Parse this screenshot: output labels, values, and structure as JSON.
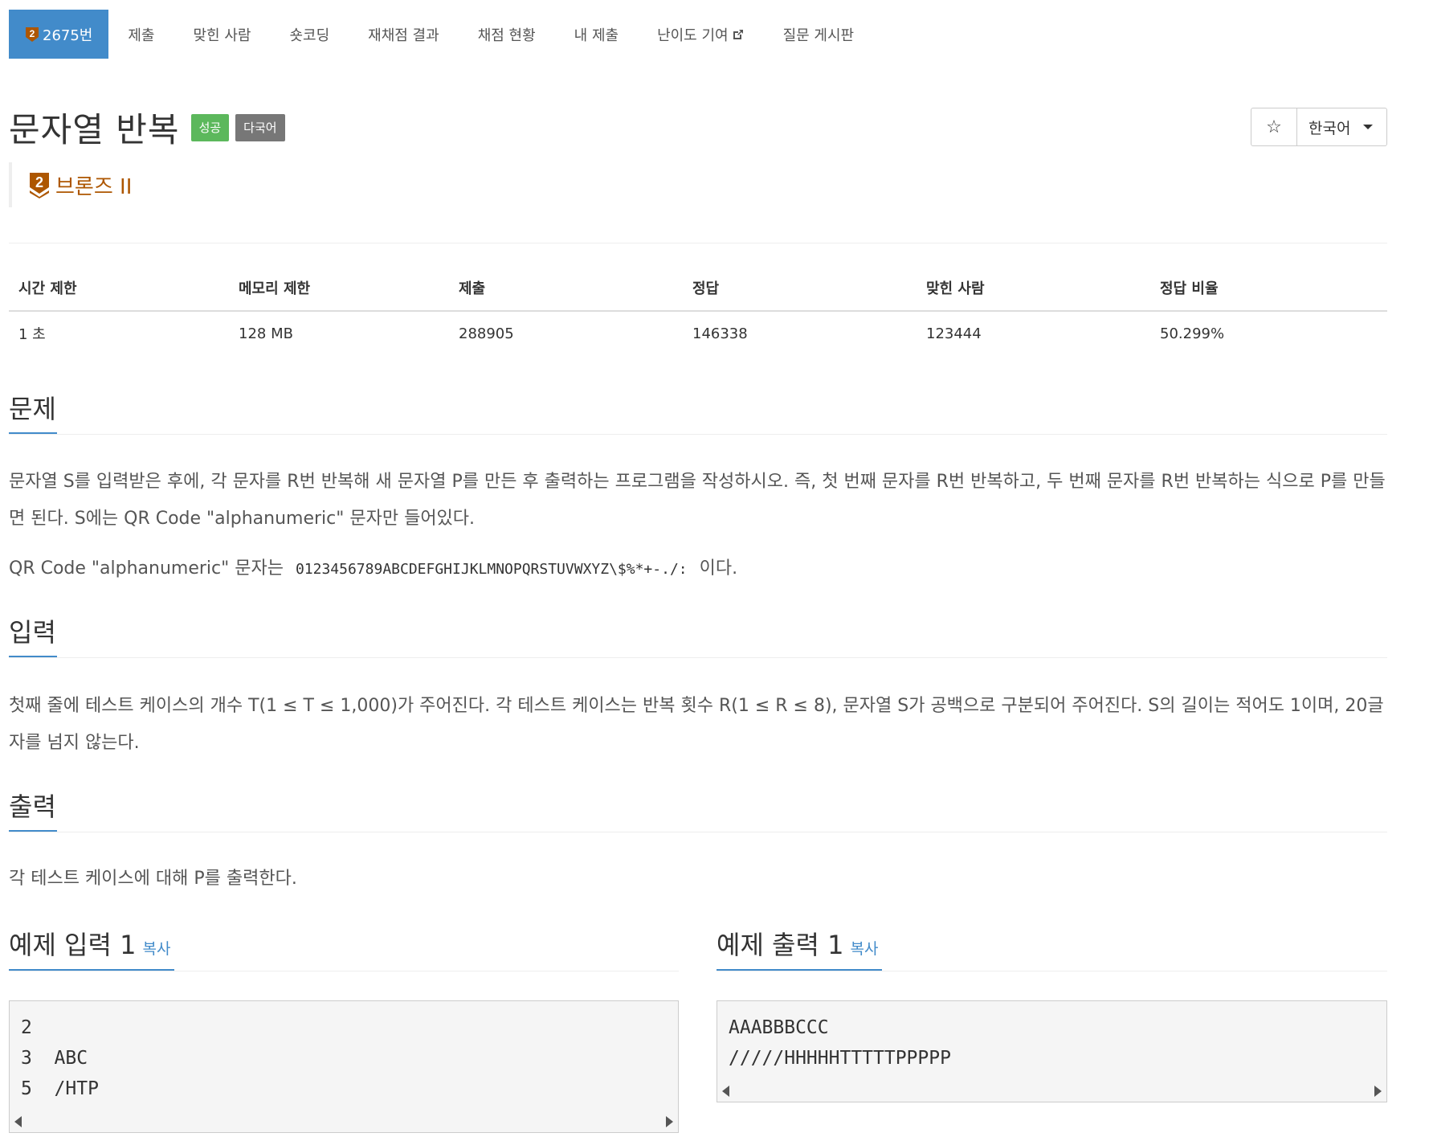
{
  "nav": {
    "items": [
      {
        "label": "2675번",
        "active": true
      },
      {
        "label": "제출"
      },
      {
        "label": "맞힌 사람"
      },
      {
        "label": "숏코딩"
      },
      {
        "label": "재채점 결과"
      },
      {
        "label": "채점 현황"
      },
      {
        "label": "내 제출"
      },
      {
        "label": "난이도 기여"
      },
      {
        "label": "질문 게시판"
      }
    ],
    "badge_number": "2"
  },
  "problem": {
    "title": "문자열 반복",
    "labels": [
      "성공",
      "다국어"
    ],
    "tier": "브론즈 II",
    "tier_number": "2",
    "tier_color": "#ad5600",
    "language": "한국어"
  },
  "info": {
    "headers": [
      "시간 제한",
      "메모리 제한",
      "제출",
      "정답",
      "맞힌 사람",
      "정답 비율"
    ],
    "values": [
      "1 초",
      "128 MB",
      "288905",
      "146338",
      "123444",
      "50.299%"
    ]
  },
  "sections": {
    "description": {
      "title": "문제",
      "p1": "문자열 S를 입력받은 후에, 각 문자를 R번 반복해 새 문자열 P를 만든 후 출력하는 프로그램을 작성하시오. 즉, 첫 번째 문자를 R번 반복하고, 두 번째 문자를 R번 반복하는 식으로 P를 만들면 된다. S에는 QR Code \"alphanumeric\" 문자만 들어있다.",
      "p2_prefix": "QR Code \"alphanumeric\" 문자는",
      "p2_code": "0123456789ABCDEFGHIJKLMNOPQRSTUVWXYZ\\$%*+-./:",
      "p2_suffix": "이다."
    },
    "input": {
      "title": "입력",
      "text": "첫째 줄에 테스트 케이스의 개수 T(1 ≤ T ≤ 1,000)가 주어진다. 각 테스트 케이스는 반복 횟수 R(1 ≤ R ≤ 8), 문자열 S가 공백으로 구분되어 주어진다. S의 길이는 적어도 1이며, 20글자를 넘지 않는다."
    },
    "output": {
      "title": "출력",
      "text": "각 테스트 케이스에 대해 P를 출력한다."
    }
  },
  "samples": {
    "input_title": "예제 입력 1",
    "output_title": "예제 출력 1",
    "copy_label": "복사",
    "input": "2\n3  ABC\n5  /HTP",
    "output": "AAABBBCCC\n/////HHHHHTTTTTPPPPP"
  }
}
